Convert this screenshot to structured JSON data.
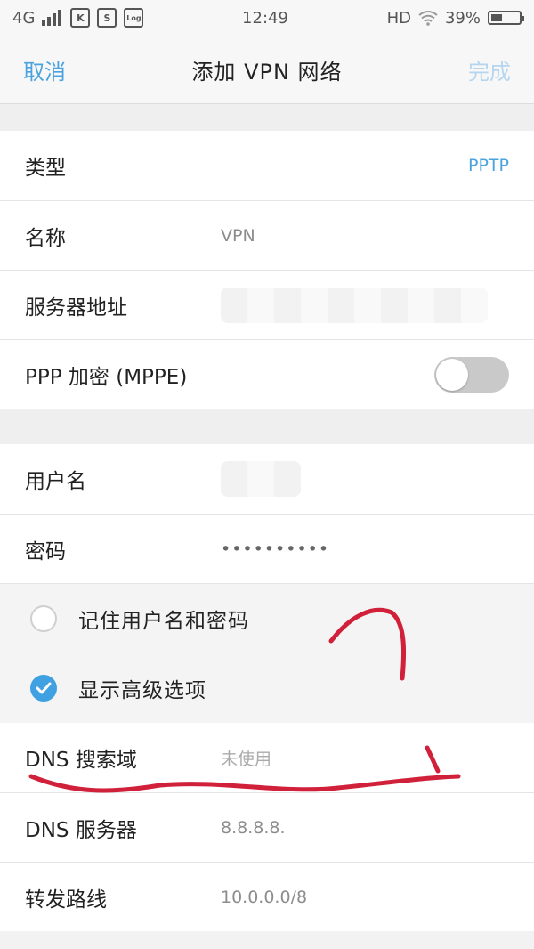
{
  "status_bar": {
    "network": "4G",
    "app_icons": [
      "K",
      "S",
      "Log"
    ],
    "time": "12:49",
    "hd": "HD",
    "battery_percent": "39%",
    "battery_level": 0.39
  },
  "nav": {
    "cancel": "取消",
    "title": "添加 VPN 网络",
    "done": "完成"
  },
  "form": {
    "type_label": "类型",
    "type_value": "PPTP",
    "name_label": "名称",
    "name_value": "VPN",
    "server_label": "服务器地址",
    "ppp_label": "PPP 加密 (MPPE)",
    "ppp_enabled": false,
    "username_label": "用户名",
    "password_label": "密码",
    "password_value": "••••••••••"
  },
  "options": {
    "remember": "记住用户名和密码",
    "remember_checked": false,
    "advanced": "显示高级选项",
    "advanced_checked": true
  },
  "advanced": {
    "dns_domain_label": "DNS 搜索域",
    "dns_domain_value": "未使用",
    "dns_server_label": "DNS 服务器",
    "dns_server_value": "8.8.8.8.",
    "route_label": "转发路线",
    "route_value": "10.0.0.0/8"
  },
  "colors": {
    "accent": "#4aa3df",
    "annotation": "#d0203a"
  }
}
